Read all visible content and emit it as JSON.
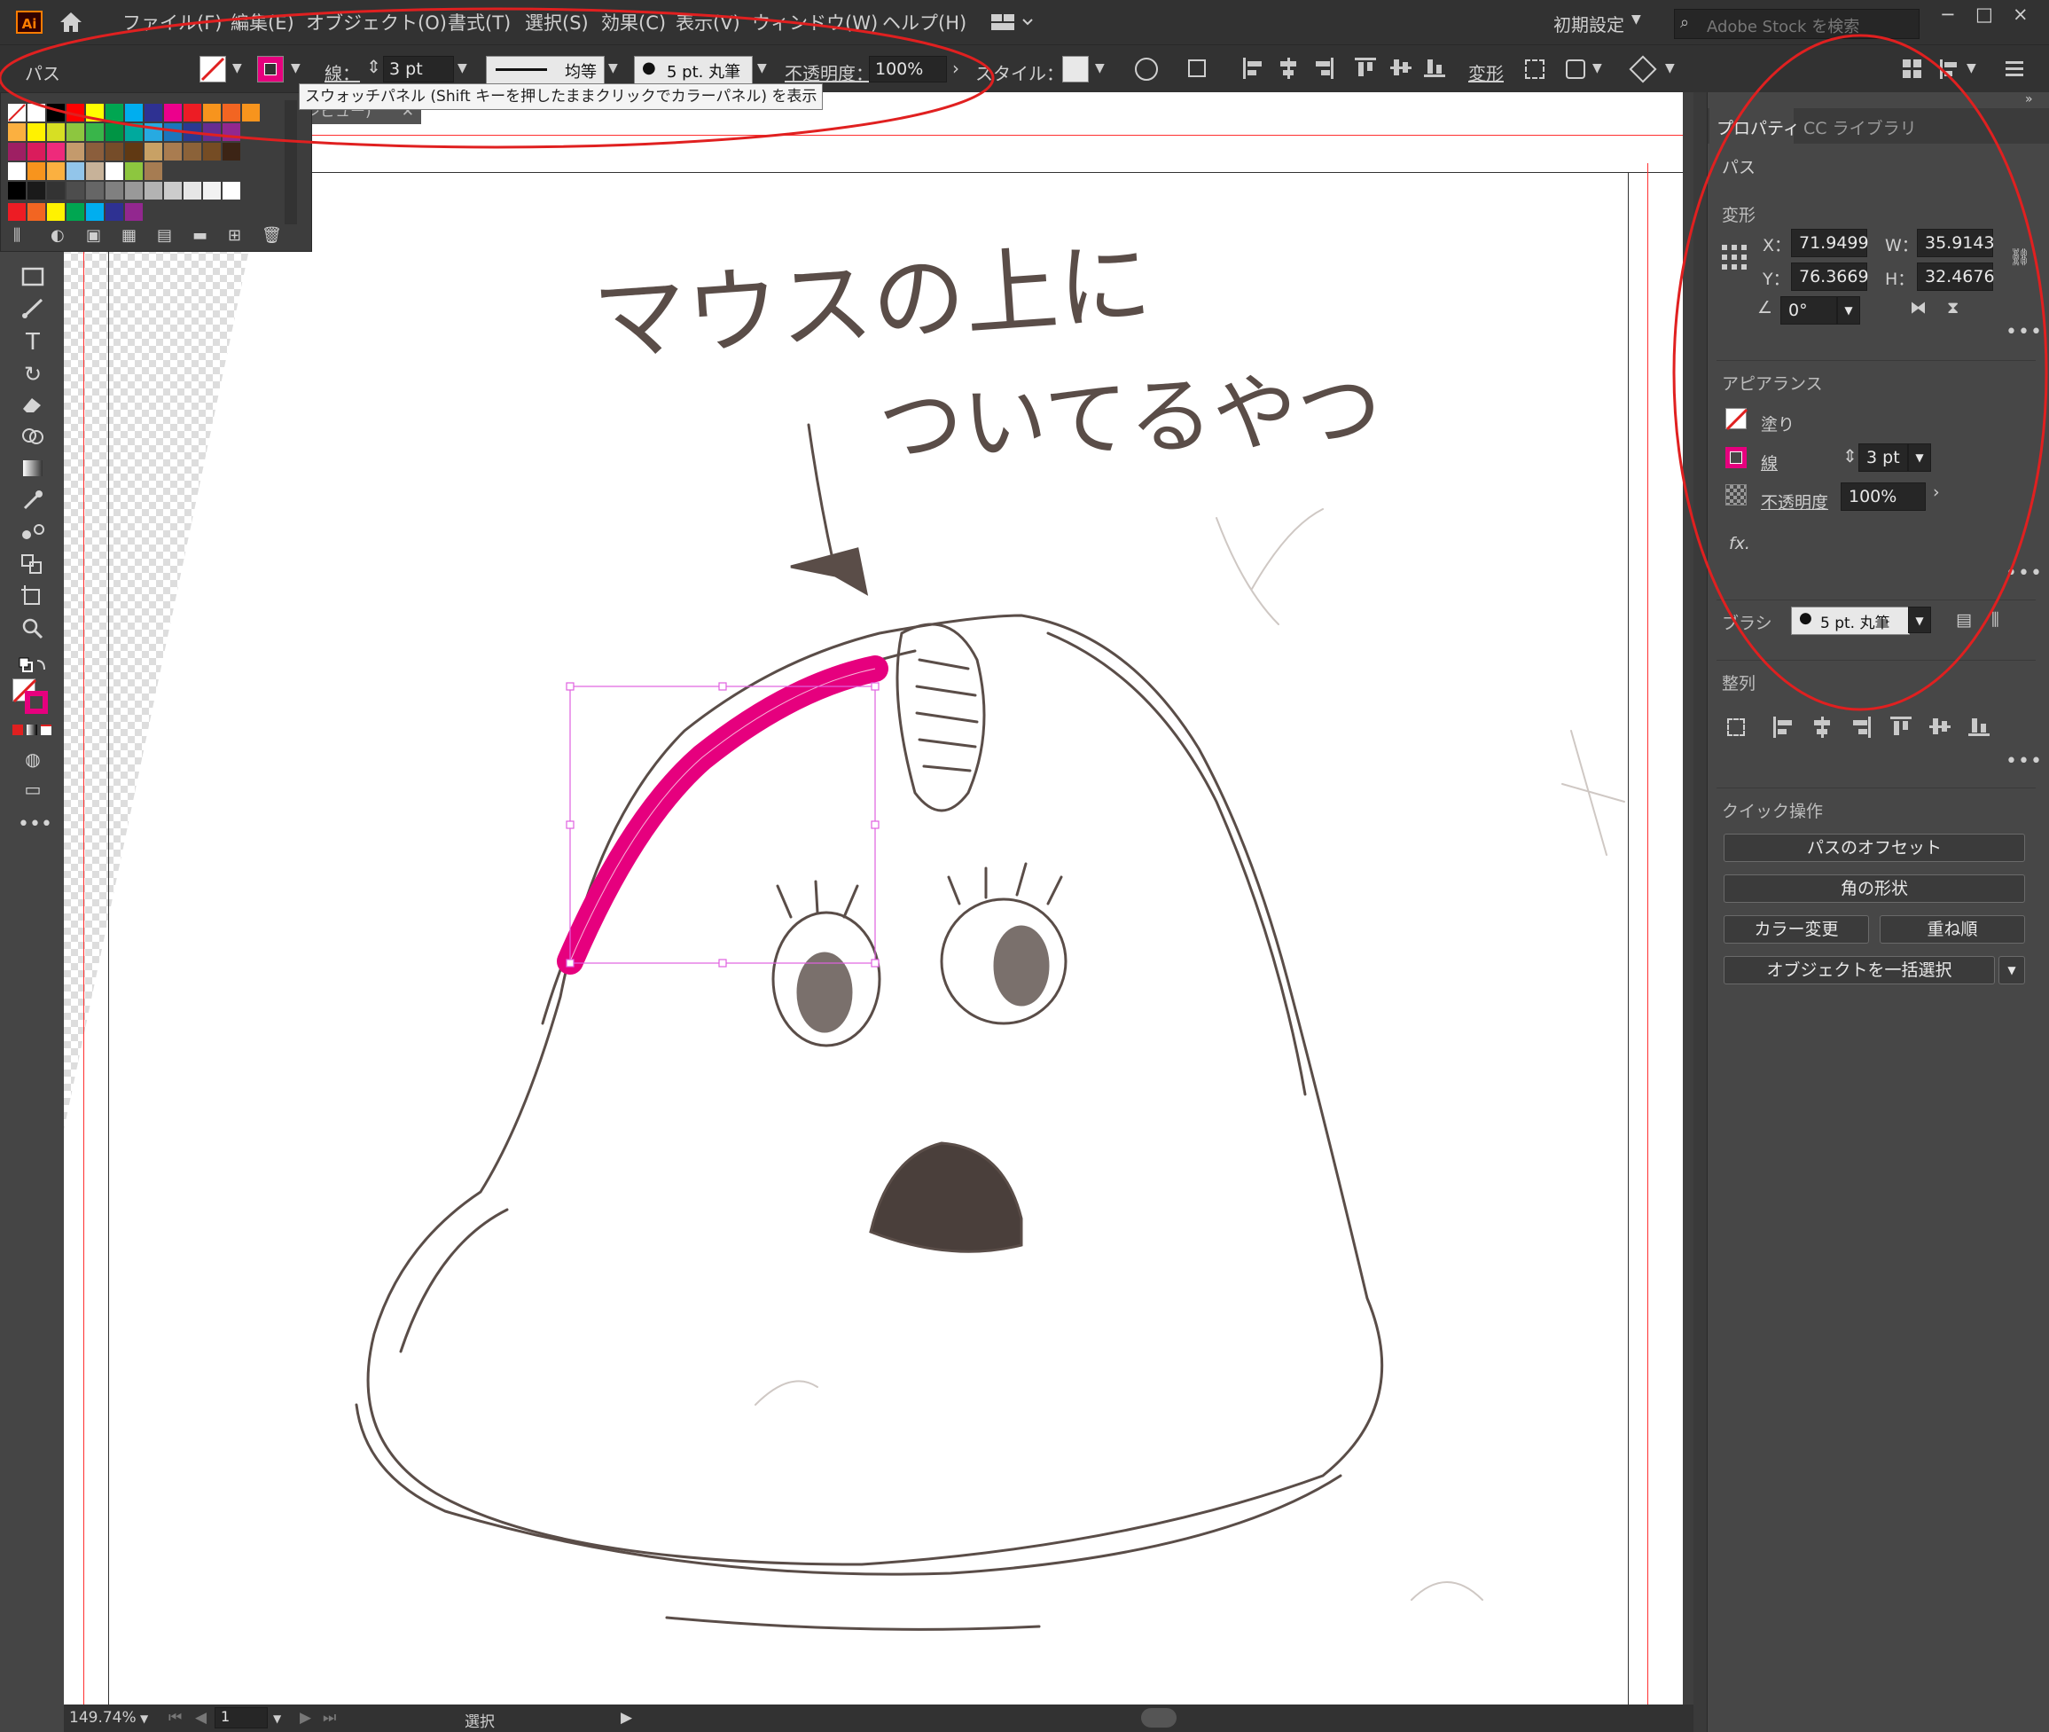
{
  "menubar": {
    "logo": "Ai",
    "items": [
      "ファイル(F)",
      "編集(E)",
      "オブジェクト(O)",
      "書式(T)",
      "選択(S)",
      "効果(C)",
      "表示(V)",
      "ウィンドウ(W)",
      "ヘルプ(H)"
    ],
    "workspace": "初期設定",
    "search_placeholder": "Adobe Stock を検索",
    "window_controls": [
      "−",
      "□",
      "×"
    ]
  },
  "controlbar": {
    "object_type": "パス",
    "stroke_label": "線：",
    "stroke_value": "3 pt",
    "profile_label": "均等",
    "brush_value": "5 pt. 丸筆",
    "opacity_label": "不透明度：",
    "opacity_value": "100%",
    "style_label": "スタイル：",
    "transform_label": "変形"
  },
  "tooltip": "スウォッチパネル (Shift キーを押したままクリックでカラーパネル) を表示",
  "document_tab": "プレビュー)",
  "swatches": {
    "row1": [
      "#ffffff",
      "#ffffff",
      "#000000",
      "#ff0000",
      "#ffff00",
      "#00a651",
      "#00aeef",
      "#2e3192",
      "#ec008c",
      "#ed1c24",
      "#f7941d",
      "#f26522",
      "#f7941d"
    ],
    "row2": [
      "#fbb040",
      "#fff200",
      "#d7df23",
      "#8dc63f",
      "#39b54a",
      "#009444",
      "#00a99d",
      "#27aae1",
      "#1c75bc",
      "#2b3990",
      "#662d91",
      "#92278f"
    ],
    "row3": [
      "#9e1f63",
      "#da1c5c",
      "#ee2a7b",
      "#c49a6c",
      "#8b5e3c",
      "#754c29",
      "#603913",
      "#c8a165",
      "#a97c50",
      "#8b6239",
      "#754c24",
      "#3c2415"
    ],
    "row4": [
      "#ffffff",
      "#f7941d",
      "#fbb040",
      "#92c5ea",
      "#c7b299",
      "#ffffff",
      "#8dc63f",
      "#a67c52"
    ],
    "row5": [
      "#000000",
      "#1a1a1a",
      "#333333",
      "#4d4d4d",
      "#666666",
      "#808080",
      "#999999",
      "#b3b3b3",
      "#cccccc",
      "#e6e6e6",
      "#f2f2f2",
      "#ffffff"
    ],
    "row6": [
      "#ed1c24",
      "#f26522",
      "#fff200",
      "#00a651",
      "#00aeef",
      "#2e3192",
      "#92278f"
    ]
  },
  "canvas": {
    "caption_line1": "マウスの上に",
    "caption_line2": "ついてるやつ",
    "stroke_color": "#e6007e"
  },
  "status": {
    "zoom": "149.74%",
    "page": "1",
    "mode": "選択"
  },
  "properties": {
    "tab_properties": "プロパティ",
    "tab_libraries": "CC ライブラリ",
    "object_type": "パス",
    "transform_title": "変形",
    "x_label": "X：",
    "x_value": "71.9499",
    "y_label": "Y：",
    "y_value": "76.3669",
    "w_label": "W：",
    "w_value": "35.9143",
    "h_label": "H：",
    "h_value": "32.4676",
    "angle_value": "0°",
    "appearance_title": "アピアランス",
    "fill_label": "塗り",
    "stroke_label": "線",
    "stroke_value": "3 pt",
    "opacity_label": "不透明度",
    "opacity_value": "100%",
    "fx_label": "fx.",
    "brush_label": "ブラシ",
    "brush_value": "5 pt. 丸筆",
    "align_title": "整列",
    "quick_title": "クイック操作",
    "btn_offset": "パスのオフセット",
    "btn_corner": "角の形状",
    "btn_recolor": "カラー変更",
    "btn_arrange": "重ね順",
    "btn_select_same": "オブジェクトを一括選択"
  },
  "colors": {
    "annotation_red": "#e02020",
    "selection_magenta": "#e6007e"
  }
}
